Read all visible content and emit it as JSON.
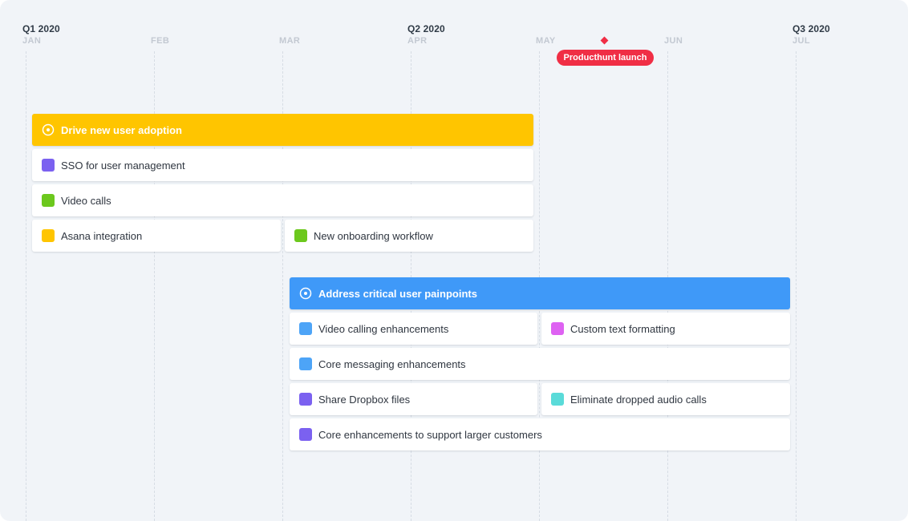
{
  "timeline": {
    "columns": [
      {
        "quarter": "Q1 2020",
        "month": "JAN"
      },
      {
        "quarter": "",
        "month": "FEB"
      },
      {
        "quarter": "",
        "month": "MAR"
      },
      {
        "quarter": "Q2 2020",
        "month": "APR"
      },
      {
        "quarter": "",
        "month": "MAY"
      },
      {
        "quarter": "",
        "month": "JUN"
      },
      {
        "quarter": "Q3 2020",
        "month": "JUL"
      }
    ]
  },
  "milestone": {
    "label": "Producthunt launch",
    "color": "#f02e45"
  },
  "goals": [
    {
      "title": "Drive new user adoption",
      "color": "#ffc500",
      "icon": "target-icon",
      "items": [
        {
          "label": "SSO for user management",
          "color": "#7b61f0"
        },
        {
          "label": "Video calls",
          "color": "#6cc81d"
        },
        {
          "label": "Asana integration",
          "color": "#ffc500"
        },
        {
          "label": "New onboarding workflow",
          "color": "#6cc81d"
        }
      ]
    },
    {
      "title": "Address critical user painpoints",
      "color": "#3f99f8",
      "icon": "target-icon",
      "items": [
        {
          "label": "Video calling enhancements",
          "color": "#4da4f7"
        },
        {
          "label": "Custom text formatting",
          "color": "#de62f2"
        },
        {
          "label": "Core messaging enhancements",
          "color": "#4da4f7"
        },
        {
          "label": "Share Dropbox files",
          "color": "#7b61f0"
        },
        {
          "label": "Eliminate dropped audio calls",
          "color": "#5adbd9"
        },
        {
          "label": "Core enhancements to support larger customers",
          "color": "#7b61f0"
        }
      ]
    }
  ]
}
